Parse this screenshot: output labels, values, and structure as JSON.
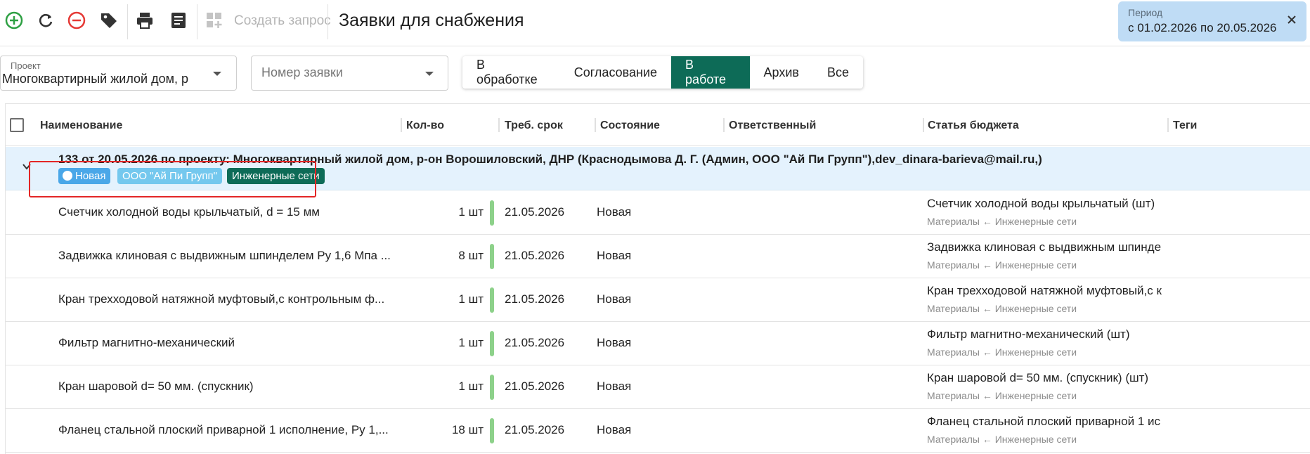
{
  "toolbar": {
    "icons": [
      "add-circle-icon",
      "refresh-icon",
      "remove-circle-icon",
      "tag-icon",
      "print-icon",
      "document-icon",
      "dashboard-add-icon"
    ],
    "create_request": "Создать запрос",
    "title": "Заявки для снабжения"
  },
  "period": {
    "label": "Период",
    "value": "с 01.02.2026 по 20.05.2026"
  },
  "filters": {
    "project_label": "Проект",
    "project_value": "Многоквартирный жилой дом, р",
    "number_placeholder": "Номер заявки"
  },
  "tabs": [
    {
      "label": "В обработке",
      "active": false
    },
    {
      "label": "Согласование",
      "active": false
    },
    {
      "label": "В работе",
      "active": true
    },
    {
      "label": "Архив",
      "active": false
    },
    {
      "label": "Все",
      "active": false
    }
  ],
  "columns": {
    "name": "Наименование",
    "qty": "Кол-во",
    "due": "Треб. срок",
    "state": "Состояние",
    "responsible": "Ответственный",
    "budget": "Статья бюджета",
    "tags": "Теги"
  },
  "group": {
    "title": "133 от 20.05.2026 по проекту: Многоквартирный жилой дом, р-он Ворошиловский, ДНР (Краснодымова Д. Г. (Админ, ООО \"Ай Пи Групп\"),dev_dinara-barieva@mail.ru,)",
    "status_badge": "Новая",
    "org_badge": "ООО \"Ай Пи Групп\"",
    "tag_badge": "Инженерные сети"
  },
  "rows": [
    {
      "name": "Счетчик холодной воды крыльчатый, d = 15 мм",
      "qty": "1 шт",
      "date": "21.05.2026",
      "state": "Новая",
      "budget": "Счетчик холодной воды крыльчатый (шт)",
      "budget_sub": "Материалы ← Инженерные сети"
    },
    {
      "name": "Задвижка клиновая с выдвижным шпинделем Ру 1,6 Мпа ...",
      "qty": "8 шт",
      "date": "21.05.2026",
      "state": "Новая",
      "budget": "Задвижка клиновая с выдвижным шпинде",
      "budget_sub": "Материалы ← Инженерные сети"
    },
    {
      "name": "Кран трехходовой натяжной муфтовый,с контрольным ф...",
      "qty": "1 шт",
      "date": "21.05.2026",
      "state": "Новая",
      "budget": "Кран трехходовой натяжной муфтовый,с к",
      "budget_sub": "Материалы ← Инженерные сети"
    },
    {
      "name": "Фильтр магнитно-механический",
      "qty": "1 шт",
      "date": "21.05.2026",
      "state": "Новая",
      "budget": "Фильтр магнитно-механический (шт)",
      "budget_sub": "Материалы ← Инженерные сети"
    },
    {
      "name": "Кран шаровой d= 50 мм. (спускник)",
      "qty": "1 шт",
      "date": "21.05.2026",
      "state": "Новая",
      "budget": "Кран шаровой d= 50 мм. (спускник) (шт)",
      "budget_sub": "Материалы ← Инженерные сети"
    },
    {
      "name": "Фланец стальной плоский приварной 1 исполнение, Ру 1,...",
      "qty": "18 шт",
      "date": "21.05.2026",
      "state": "Новая",
      "budget": "Фланец стальной плоский приварной 1 ис",
      "budget_sub": "Материалы ← Инженерные сети"
    }
  ],
  "colors": {
    "accent": "#0d6b57",
    "period_bg": "#bfdcf5",
    "group_bg": "#e4f2fd",
    "qty_indicator": "#8dd18a",
    "highlight": "#e32626"
  }
}
